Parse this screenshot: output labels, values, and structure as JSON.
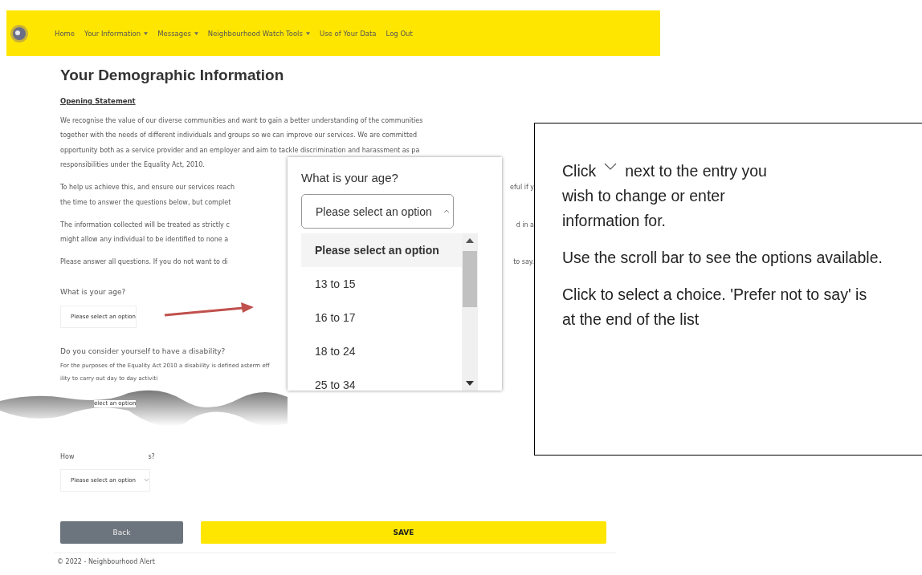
{
  "nav": {
    "items": [
      {
        "label": "Home",
        "has_menu": false
      },
      {
        "label": "Your Information",
        "has_menu": true
      },
      {
        "label": "Messages",
        "has_menu": true
      },
      {
        "label": "Neighbourhood Watch Tools",
        "has_menu": true
      },
      {
        "label": "Use of Your Data",
        "has_menu": false
      },
      {
        "label": "Log Out",
        "has_menu": false
      }
    ]
  },
  "page": {
    "title": "Your Demographic Information",
    "section_heading": "Opening Statement",
    "paragraphs": [
      {
        "lines": [
          {
            "left": "We recognise the value of our diverse communities and want to gain a better understanding of the communities"
          },
          {
            "left": "together with the needs of different individuals and groups so we can improve our services. We are committed"
          },
          {
            "left": "opportunity both as a service provider and an employer and aim to tackle discrimination and harassment as pa"
          },
          {
            "left": "responsibilities under the Equality Act, 2010."
          }
        ]
      },
      {
        "lines": [
          {
            "left": "To help us achieve this, and ensure our services reach",
            "right": "eful if y"
          },
          {
            "left": "the time to answer the questions below, but complet"
          }
        ]
      },
      {
        "lines": [
          {
            "left": "The information collected will be treated as strictly c",
            "right": "d in a"
          },
          {
            "left": "might allow any individual to be identified to none a"
          }
        ]
      },
      {
        "lines": [
          {
            "left": "Please answer all questions. If you do not want to di",
            "right": "to say."
          }
        ]
      }
    ],
    "age_field": {
      "label": "What is your age?",
      "value": "Please select an option"
    },
    "disability": {
      "label": "Do you consider yourself to have a disability?",
      "note_lines": [
        {
          "left": "For the purposes of the Equality Act 2010 a disability is defined as",
          "right": "term eff"
        },
        {
          "left": "ility to carry out day to day activiti"
        }
      ]
    },
    "torn_field_value": "elect an option",
    "last_field": {
      "label_start": "How",
      "label_end": "s?",
      "value": "Please select an option"
    },
    "buttons": [
      {
        "label": "Back",
        "kind": "secondary"
      },
      {
        "label": "SAVE",
        "kind": "primary"
      }
    ],
    "footer": "© 2022 - Neighbourhood Alert"
  },
  "popup": {
    "label": "What is your age?",
    "value": "Please select an option",
    "expanded": true,
    "options": [
      {
        "label": "Please select an option",
        "selected": true
      },
      {
        "label": "13 to 15",
        "selected": false
      },
      {
        "label": "16 to 17",
        "selected": false
      },
      {
        "label": "18 to 24",
        "selected": false
      },
      {
        "label": "25 to 34",
        "selected": false
      }
    ]
  },
  "callout": {
    "intro_before": "Click",
    "intro_after": "next to the entry you",
    "intro_rest": "wish to change or enter information for.",
    "paragraphs": [
      "Use the scroll bar to see the options available.",
      "Click to select a choice. 'Prefer not to say' is at the end of the list"
    ]
  }
}
